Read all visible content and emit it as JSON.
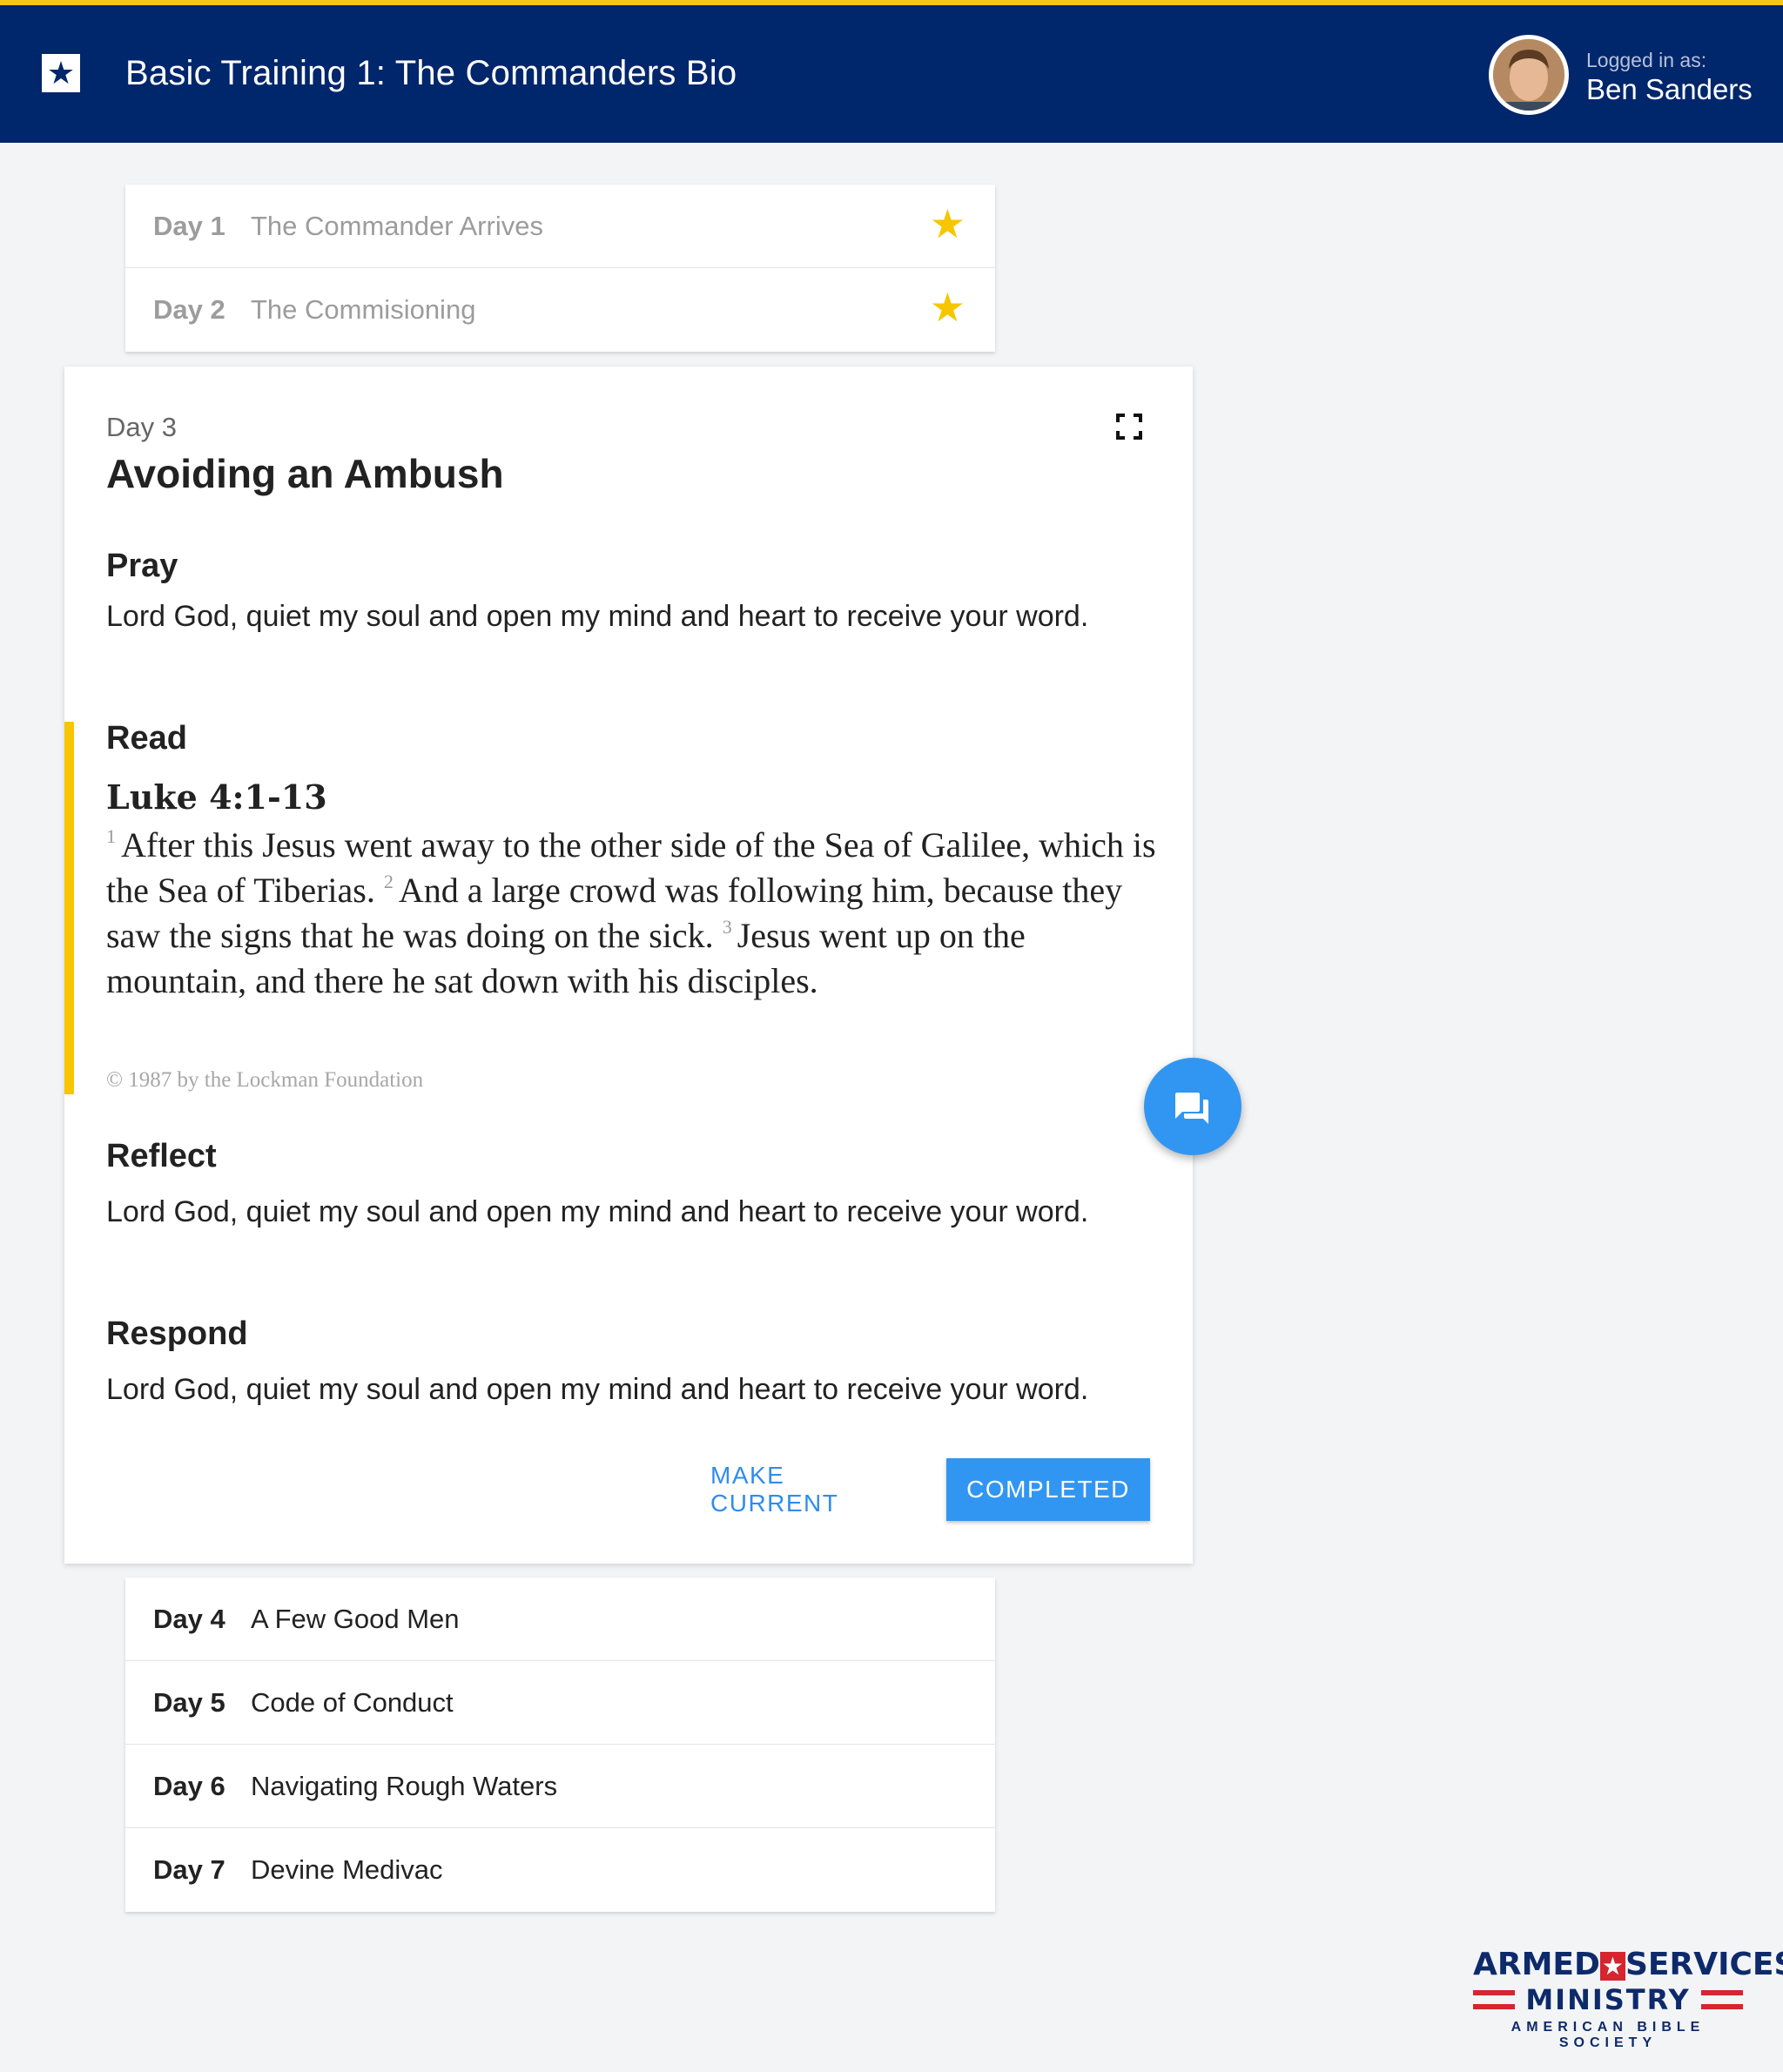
{
  "header": {
    "title": "Basic Training 1: The Commanders Bio",
    "login_label": "Logged in as:",
    "user_name": "Ben Sanders"
  },
  "completed_days": [
    {
      "day": "Day 1",
      "title": "The Commander Arrives",
      "completed": true
    },
    {
      "day": "Day 2",
      "title": "The Commisioning",
      "completed": true
    }
  ],
  "current_day": {
    "day_label": "Day 3",
    "title": "Avoiding an Ambush",
    "pray": {
      "title": "Pray",
      "text": "Lord God, quiet my soul and open my mind and heart to receive your word."
    },
    "read": {
      "title": "Read",
      "reference": "Luke 4:1-13",
      "verses": [
        {
          "num": "1",
          "text": "After this  Jesus went away to the other side of  the Sea of Galilee, which is the Sea of Tiberias."
        },
        {
          "num": "2",
          "text": "And a large crowd was following him, because they saw the signs that he was doing on the sick."
        },
        {
          "num": "3",
          "text": "Jesus went up on the mountain, and there he sat down with his disciples."
        }
      ],
      "copyright": "© 1987 by the Lockman Foundation"
    },
    "reflect": {
      "title": "Reflect",
      "text": "Lord God, quiet my soul and open my mind and heart to receive your word."
    },
    "respond": {
      "title": "Respond",
      "text": "Lord God, quiet my soul and open my mind and heart to receive your word."
    },
    "actions": {
      "make_current": "MAKE CURRENT",
      "completed": "COMPLETED"
    }
  },
  "upcoming_days": [
    {
      "day": "Day 4",
      "title": "A Few Good Men"
    },
    {
      "day": "Day 5",
      "title": "Code of Conduct"
    },
    {
      "day": "Day 6",
      "title": "Navigating Rough Waters"
    },
    {
      "day": "Day 7",
      "title": "Devine Medivac"
    }
  ],
  "brand": {
    "line1_a": "ARMED",
    "line1_b": "SERVICES",
    "line2": "MINISTRY",
    "line3": "AMERICAN BIBLE SOCIETY"
  },
  "colors": {
    "header_bg": "#00266b",
    "accent_yellow": "#f7c600",
    "primary_blue": "#3196f1"
  }
}
